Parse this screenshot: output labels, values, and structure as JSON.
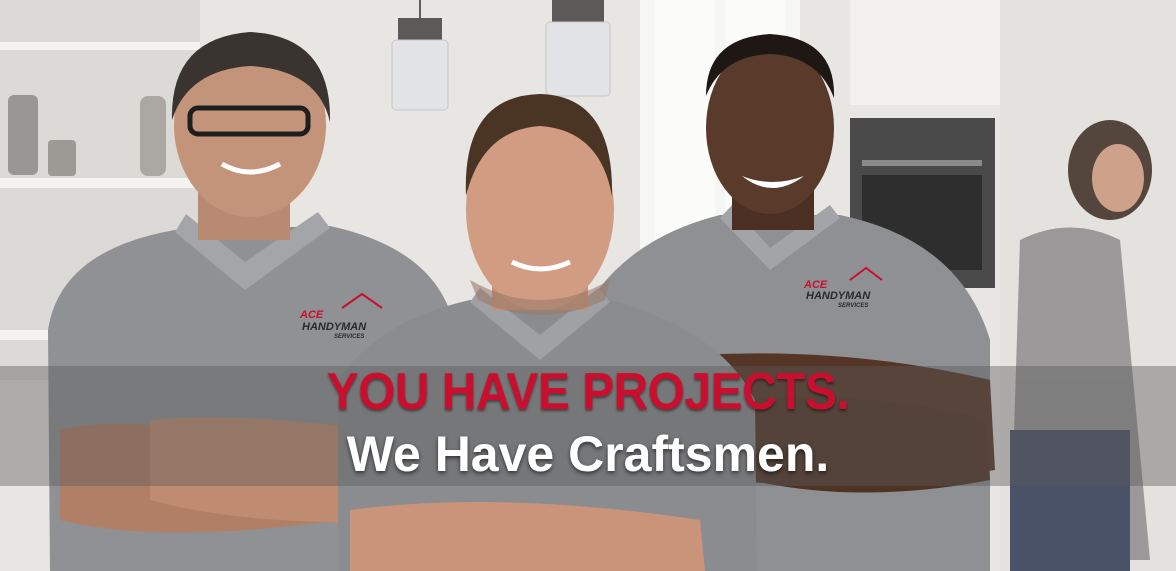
{
  "hero": {
    "headline_primary": "YOU HAVE PROJECTS.",
    "headline_secondary": "We Have Craftsmen."
  },
  "shirt_logo": {
    "brand_word": "ACE",
    "service_word": "HANDYMAN",
    "sub_word": "SERVICES"
  },
  "colors": {
    "headline_red": "#c8102e",
    "headline_white": "#ffffff",
    "shirt_gray": "#8e9093",
    "banner_overlay": "rgba(90,90,90,0.42)"
  }
}
